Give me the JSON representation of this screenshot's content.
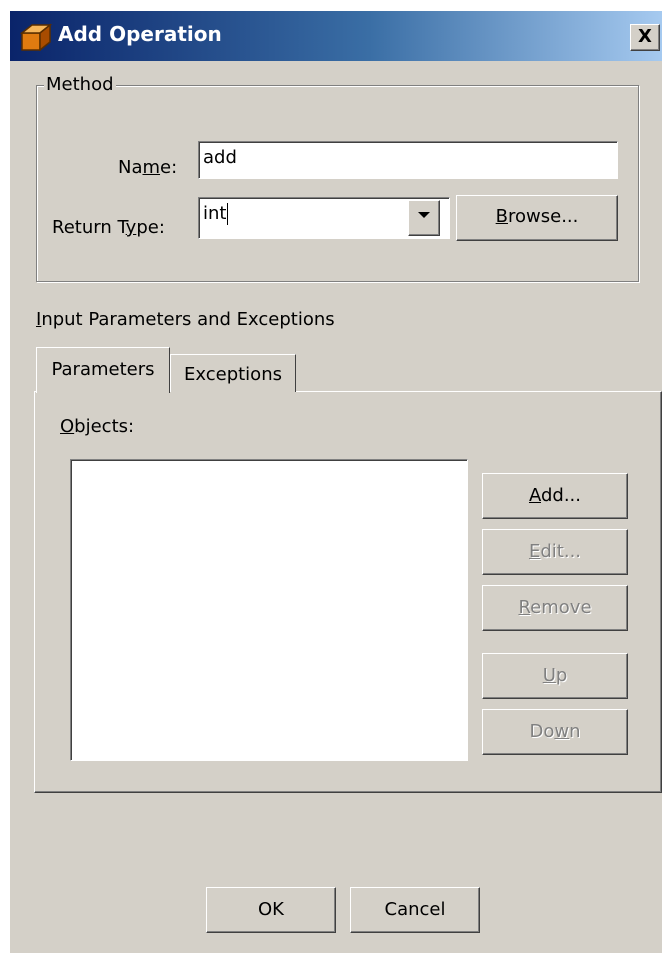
{
  "window": {
    "title": "Add Operation",
    "close_glyph": "X"
  },
  "method": {
    "group_label": "Method",
    "name_label_pre": "Na",
    "name_label_mn": "m",
    "name_label_post": "e:",
    "name_value": "add",
    "return_label_pre": "Return T",
    "return_label_mn": "y",
    "return_label_post": "pe:",
    "return_value": "int",
    "browse_mn": "B",
    "browse_rest": "rowse..."
  },
  "params": {
    "section_mn": "I",
    "section_rest": "nput Parameters and Exceptions",
    "tabs": [
      {
        "label": "Parameters",
        "active": true
      },
      {
        "label": "Exceptions",
        "active": false
      }
    ],
    "objects_mn": "O",
    "objects_rest": "bjects:",
    "add_mn": "A",
    "add_rest": "dd...",
    "edit_mn": "E",
    "edit_rest": "dit...",
    "remove_mn": "R",
    "remove_rest": "emove",
    "up_mn": "U",
    "up_rest": "p",
    "down_pre": "Do",
    "down_mn": "w",
    "down_rest": "n"
  },
  "footer": {
    "ok_label": "OK",
    "cancel_label": "Cancel"
  }
}
